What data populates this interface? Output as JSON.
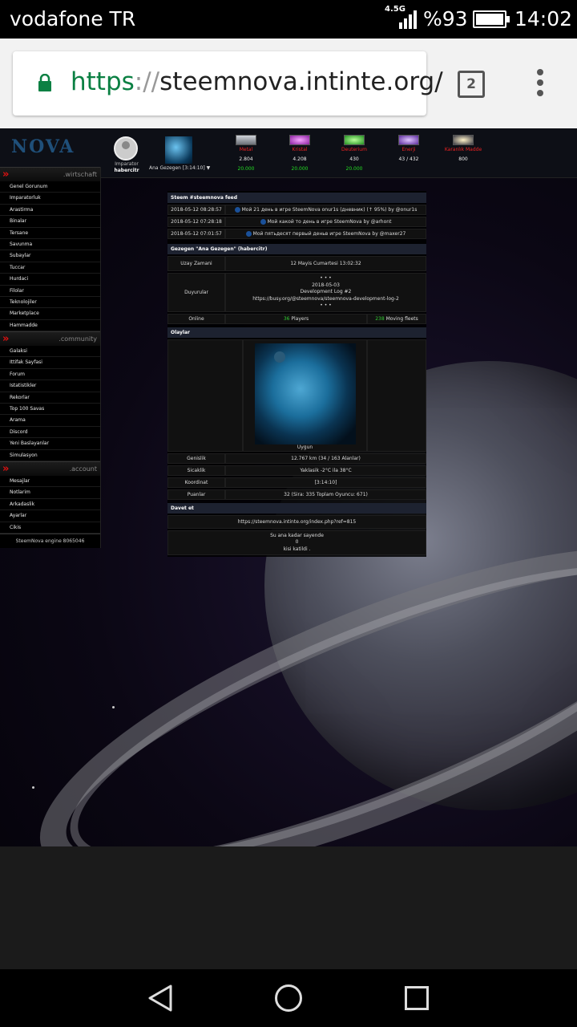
{
  "status_bar": {
    "carrier": "vodafone TR",
    "network": "4.5G",
    "battery": "%93",
    "time": "14:02"
  },
  "browser": {
    "url_scheme": "https",
    "url_sep": "://",
    "url_host": "steemnova.intinte.org/",
    "tab_count": "2"
  },
  "game": {
    "logo": "NOVA",
    "player": {
      "role": "Imparator",
      "name": "habercitr"
    },
    "planet_select": "Ana Gezegen [3:14:10] ▼",
    "resources": [
      {
        "name": "Metal",
        "value": "2.804",
        "max": "20.000",
        "color": "#9aa0a8"
      },
      {
        "name": "Kristal",
        "value": "4.208",
        "max": "20.000",
        "color": "#c04bd0"
      },
      {
        "name": "Deuterium",
        "value": "430",
        "max": "20.000",
        "color": "#3fcf3f"
      },
      {
        "name": "Enerji",
        "value": "43 / 432",
        "max": "",
        "color": "#9b6ed8"
      },
      {
        "name": "Karanlık Madde",
        "value": "800",
        "max": "",
        "color": "#c9c9c9"
      }
    ]
  },
  "sidebar": {
    "sections": [
      {
        "label": ".wirtschaft",
        "items": [
          "Genel Gorunum",
          "Imparatorluk",
          "Arastirma",
          "Binalar",
          "Tersane",
          "Savunma",
          "Subaylar",
          "Tuccar",
          "Hurdaci",
          "Filolar",
          "Teknolojiler",
          "Marketplace",
          "Hammadde"
        ]
      },
      {
        "label": ".community",
        "items": [
          "Galaksi",
          "Ittifak Sayfasi",
          "Forum",
          "Istatistikler",
          "Rekorlar",
          "Top 100 Savas",
          "Arama",
          "Discord",
          "Yeni Baslayanlar",
          "Simulasyon"
        ]
      },
      {
        "label": ".account",
        "items": [
          "Mesajlar",
          "Notlarim",
          "Arkadaslik",
          "Ayarlar",
          "Cikis"
        ]
      }
    ],
    "footer": "SteemNova engine 8065046"
  },
  "feed": {
    "title": "Steem #steemnova feed",
    "rows": [
      {
        "time": "2018-05-12 08:28:57",
        "text": "Мой 21 день в игре SteemNova onur1s (дневник) (↑ 95%) by @onur1s"
      },
      {
        "time": "2018-05-12 07:28:18",
        "text": "Мой какой то день в игре SteemNova by @arhont"
      },
      {
        "time": "2018-05-12 07:01:57",
        "text": "Мой пятьдесят первый деньв игре SteemNova by @maxer27"
      }
    ]
  },
  "planet": {
    "title": "Gezegen \"Ana Gezegen\" (habercitr)",
    "space_time_label": "Uzay Zamani",
    "space_time": "12 Mayis Cumartesi 13:02:32",
    "announce_label": "Duyurular",
    "announce_dots": "• • •",
    "announce_date": "2018-05-03",
    "announce_title": "Development Log #2",
    "announce_link": "https://busy.org/@steemnova/steemnova-development-log-2",
    "online_label": "Online",
    "players_count": "36",
    "players_label": "Players",
    "fleets_count": "238",
    "fleets_label": "Moving fleets"
  },
  "events": {
    "title": "Olaylar",
    "planet_caption": "Uygun",
    "rows": [
      {
        "label": "Genislik",
        "value": "12.767 km (34 / 163 Alanlar)"
      },
      {
        "label": "Sicaklik",
        "value": "Yaklasik -2°C ila 38°C"
      },
      {
        "label": "Koordinat",
        "value": "[3:14:10]"
      },
      {
        "label": "Puanlar",
        "value": "32 (Sira: 335 Toplam Oyuncu: 671)"
      }
    ]
  },
  "invite": {
    "title": "Davet et",
    "link": "https://steemnova.intinte.org/index.php?ref=815",
    "line1": "Su ana kadar sayende",
    "line2": "0",
    "line3": "kisi katildi ."
  }
}
